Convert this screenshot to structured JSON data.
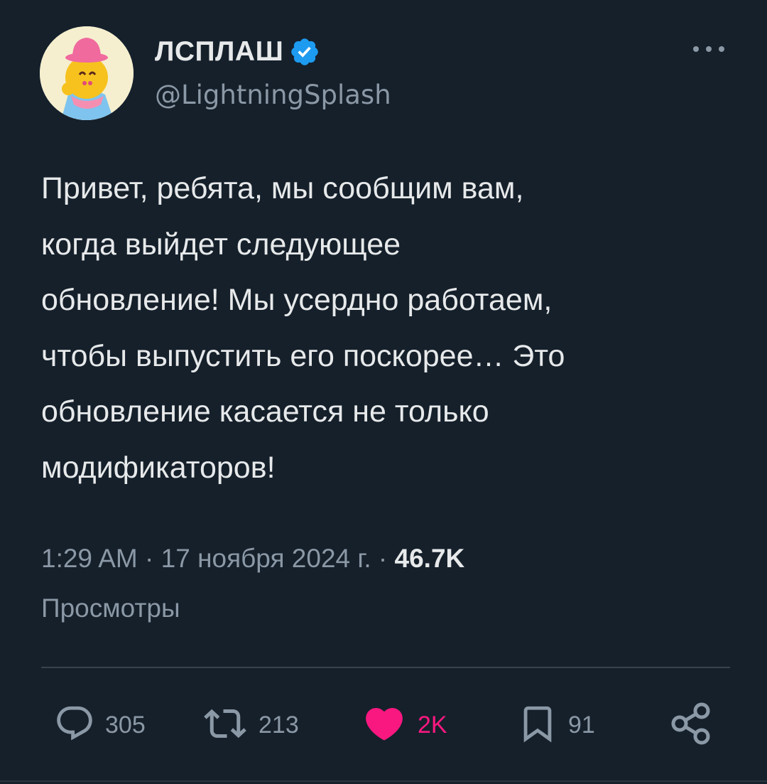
{
  "author": {
    "display_name": "ЛСПЛАШ",
    "handle": "@LightningSplash",
    "verified": true,
    "avatar_icon": "yellow-character-avatar"
  },
  "tweet": {
    "text": "Привет, ребята, мы сообщим вам,\nкогда выйдет следующее\nобновление! Мы усердно работаем,\nчтобы выпустить его поскорее… Это\nобновление касается не только\nмодификаторов!",
    "timestamp": "1:29 AM · 17 ноября 2024 г. · ",
    "views_count": "46.7K",
    "views_label": "Просмотры"
  },
  "actions": {
    "reply": {
      "icon": "reply-icon",
      "count": "305"
    },
    "retweet": {
      "icon": "retweet-icon",
      "count": "213"
    },
    "like": {
      "icon": "heart-icon",
      "count": "2K",
      "liked": true
    },
    "bookmark": {
      "icon": "bookmark-icon",
      "count": "91"
    },
    "share": {
      "icon": "share-icon"
    }
  },
  "colors": {
    "background": "#15202b",
    "text": "#e7e9ea",
    "secondary": "#8b98a5",
    "verified_blue": "#1d9bf0",
    "like_pink": "#f91880",
    "divider": "#38444d"
  }
}
